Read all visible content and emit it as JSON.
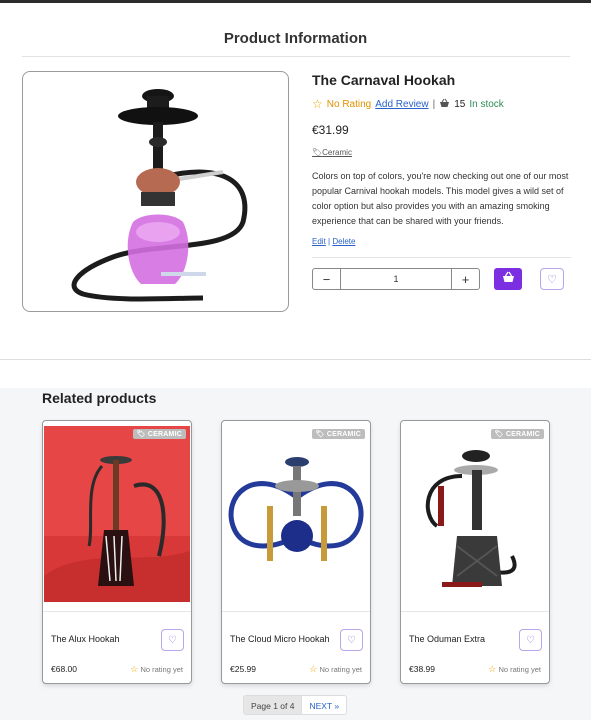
{
  "section_title": "Product Information",
  "product": {
    "name": "The Carnaval Hookah",
    "rating_text": "No Rating",
    "add_review": "Add Review",
    "separator": "|",
    "stock_count": "15",
    "stock_status": "In stock",
    "price": "€31.99",
    "tag": "Ceramic",
    "description": "Colors on top of colors, you're now checking out one of our most popular Carnival hookah models. This model gives a wild set of color option but also provides you with an amazing smoking experience that can be shared with your friends.",
    "edit_label": "Edit",
    "delete_label": "Delete",
    "quantity": "1",
    "minus_label": "−",
    "plus_label": "+"
  },
  "related": {
    "title": "Related products",
    "items": [
      {
        "name": "The Alux Hookah",
        "price": "€68.00",
        "tag": "CERAMIC",
        "rating": "No rating yet"
      },
      {
        "name": "The Cloud Micro Hookah",
        "price": "€25.99",
        "tag": "CERAMIC",
        "rating": "No rating yet"
      },
      {
        "name": "The Oduman Extra",
        "price": "€38.99",
        "tag": "CERAMIC",
        "rating": "No rating yet"
      }
    ]
  },
  "pagination": {
    "info": "Page 1 of 4",
    "next": "NEXT »"
  },
  "colors": {
    "accent": "#7c2fe0",
    "link": "#2a62c9",
    "stock": "#2e8b57",
    "star": "#f0a500"
  },
  "icons": [
    "star-icon",
    "basket-icon",
    "cart-icon",
    "heart-icon",
    "tag-icon"
  ]
}
